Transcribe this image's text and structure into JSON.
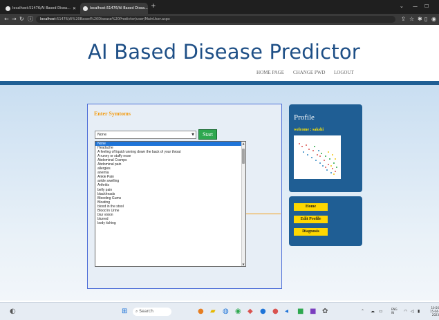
{
  "browser": {
    "tabs": [
      {
        "title": "localhost:51476/AI Based Disea..."
      },
      {
        "title": "localhost:51476/AI Based Disea..."
      }
    ],
    "url_host": "localhost",
    "url_path": ":51476/AI%20Based%20Disease%20Predictor/user/MainUser.aspx"
  },
  "header": {
    "title": "AI Based Disease Predictor",
    "nav": [
      "HOME PAGE",
      "CHANGE PWD",
      "LOGOUT"
    ]
  },
  "symptoms": {
    "heading": "Enter Symtoms",
    "selected": "None",
    "start_label": "Start",
    "options": [
      "None",
      "Headache",
      "A feeling of liquid running down the back of your throat",
      "A runny or stuffy nose",
      "Abdominal Cramps",
      "Abdominal pain",
      "allergies",
      "anemia",
      "Ankle Pain",
      "ankle swelling",
      "Arthritis",
      "belly pain",
      "blackheads",
      "Bleeding Gums",
      "Bloating",
      "blood in the stool",
      "Blood in Urine",
      "blur vision",
      "blurred",
      "body itching"
    ]
  },
  "profile": {
    "title": "Profile",
    "welcome": "welcome : sakshi"
  },
  "menu": {
    "home": "Home",
    "edit_profile": "Edit Profile",
    "diagnosis": "Diagnosis"
  },
  "taskbar": {
    "search_label": "Search",
    "lang": "ENG",
    "region": "IN",
    "time": "10:56",
    "date": "15-04-2023"
  },
  "colors": {
    "title_blue": "#1e4f86",
    "panel_blue": "#1f5e94",
    "accent_orange": "#f39c12",
    "menu_yellow": "#ffd700",
    "start_green": "#2ea84f"
  }
}
